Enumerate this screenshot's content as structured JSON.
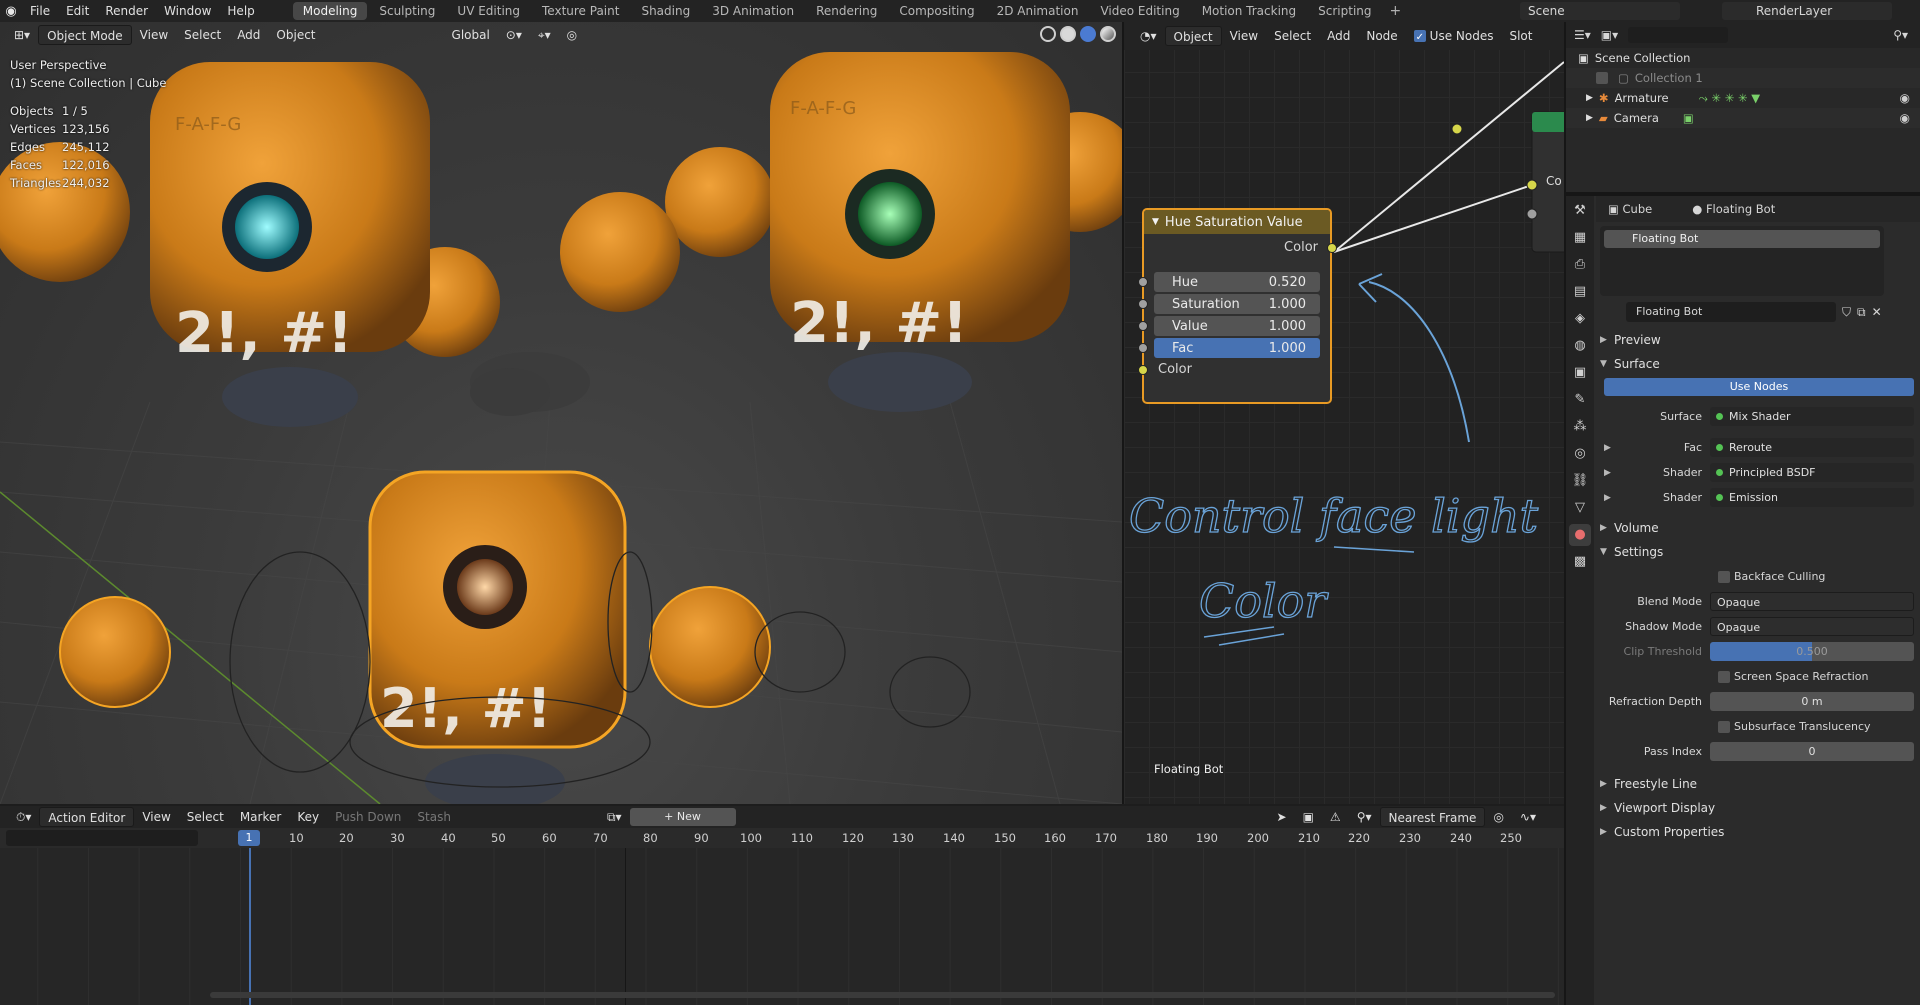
{
  "topbar": {
    "menus": [
      "File",
      "Edit",
      "Render",
      "Window",
      "Help"
    ],
    "workspaces": [
      "Modeling",
      "Sculpting",
      "UV Editing",
      "Texture Paint",
      "Shading",
      "3D Animation",
      "Rendering",
      "Compositing",
      "2D Animation",
      "Video Editing",
      "Motion Tracking",
      "Scripting"
    ],
    "active_workspace": "Modeling",
    "scene": "Scene",
    "view_layer": "RenderLayer"
  },
  "viewport": {
    "mode": "Object Mode",
    "menus": [
      "View",
      "Select",
      "Add",
      "Object"
    ],
    "transform_orientation": "Global",
    "perspective": "User Perspective",
    "collection_info": "(1) Scene Collection | Cube",
    "stats": [
      {
        "label": "Objects",
        "value": "1 / 5"
      },
      {
        "label": "Vertices",
        "value": "123,156"
      },
      {
        "label": "Edges",
        "value": "245,112"
      },
      {
        "label": "Faces",
        "value": "122,016"
      },
      {
        "label": "Triangles",
        "value": "244,032"
      }
    ],
    "robot_text": "F-A-F-G",
    "robot_decal": "2!, #!",
    "colors": {
      "robot_body": "#d98a1e",
      "eye_cyan": "#3ff0ff",
      "eye_green": "#35ff6a",
      "eye_orange": "#ffb36b",
      "selection_outline": "#f5a524"
    }
  },
  "node_editor": {
    "type": "Object",
    "menus": [
      "View",
      "Select",
      "Add",
      "Node"
    ],
    "use_nodes_label": "Use Nodes",
    "slot_label": "Slot",
    "node": {
      "title": "Hue Saturation Value",
      "output": "Color",
      "inputs": [
        {
          "label": "Hue",
          "value": "0.520"
        },
        {
          "label": "Saturation",
          "value": "1.000"
        },
        {
          "label": "Value",
          "value": "1.000"
        },
        {
          "label": "Fac",
          "value": "1.000"
        }
      ],
      "color_input": "Color"
    },
    "partial_node_label": "Co",
    "annotation_line1": "Control face light",
    "annotation_line2": "Color",
    "footer": "Floating Bot"
  },
  "outliner": {
    "root": "Scene Collection",
    "items": [
      {
        "label": "Collection 1",
        "depth": 1
      },
      {
        "label": "Armature",
        "depth": 1
      },
      {
        "label": "Camera",
        "depth": 1
      }
    ]
  },
  "properties": {
    "object": "Cube",
    "material": "Floating Bot",
    "slot_name": "Floating Bot",
    "material_field": "Floating Bot",
    "panels": {
      "preview": "Preview",
      "surface": "Surface",
      "use_nodes": "Use Nodes",
      "volume": "Volume",
      "settings": "Settings",
      "freestyle": "Freestyle Line",
      "viewport_display": "Viewport Display",
      "custom_props": "Custom Properties"
    },
    "surface_rows": [
      {
        "label": "Surface",
        "value": "Mix Shader"
      },
      {
        "label": "Fac",
        "value": "Reroute"
      },
      {
        "label": "Shader",
        "value": "Principled BSDF"
      },
      {
        "label": "Shader",
        "value": "Emission"
      }
    ],
    "settings": {
      "backface_culling": "Backface Culling",
      "blend_mode_label": "Blend Mode",
      "blend_mode": "Opaque",
      "shadow_mode_label": "Shadow Mode",
      "shadow_mode": "Opaque",
      "clip_threshold_label": "Clip Threshold",
      "clip_threshold": "0.500",
      "ssr": "Screen Space Refraction",
      "refraction_depth_label": "Refraction Depth",
      "refraction_depth": "0 m",
      "sss": "Subsurface Translucency",
      "pass_index_label": "Pass Index",
      "pass_index": "0"
    }
  },
  "timeline": {
    "editor": "Action Editor",
    "menus": [
      "View",
      "Select",
      "Marker",
      "Key"
    ],
    "push_down": "Push Down",
    "stash": "Stash",
    "new_label": "New",
    "snapping": "Nearest Frame",
    "current_frame": "1",
    "ticks": [
      "10",
      "20",
      "30",
      "40",
      "50",
      "60",
      "70",
      "80",
      "90",
      "100",
      "110",
      "120",
      "130",
      "140",
      "150",
      "160",
      "170",
      "180",
      "190",
      "200",
      "210",
      "220",
      "230",
      "240",
      "250"
    ]
  }
}
